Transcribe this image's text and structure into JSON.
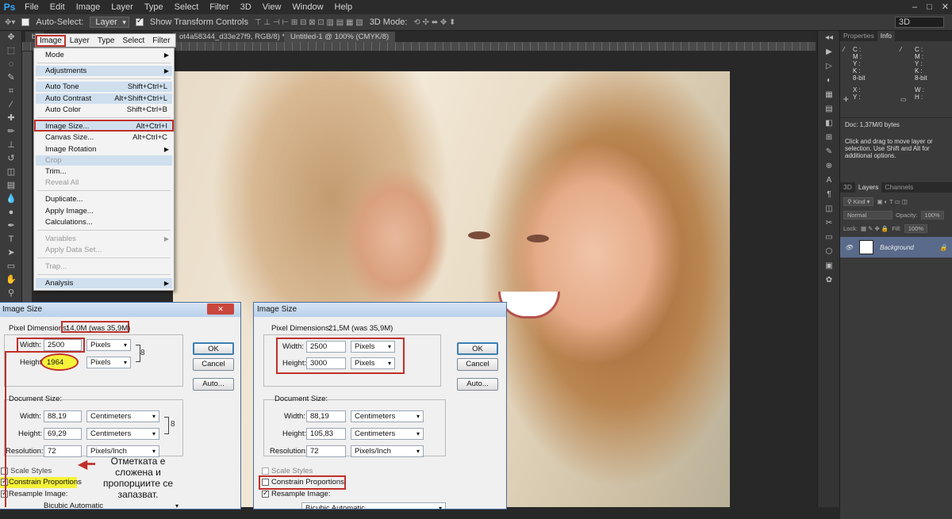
{
  "app": {
    "logo": "Ps",
    "menu": [
      "File",
      "Edit",
      "Image",
      "Layer",
      "Type",
      "Select",
      "Filter",
      "3D",
      "View",
      "Window",
      "Help"
    ],
    "window_controls": [
      "–",
      "□",
      "✕"
    ]
  },
  "options_bar": {
    "auto_select_label": "Auto-Select:",
    "auto_select_value": "Layer",
    "show_transform_label": "Show Transform Controls",
    "three_d_mode_label": "3D Mode:",
    "workspace_value": "3D"
  },
  "tabs": [
    {
      "label": "bl"
    },
    {
      "label": "ot4a58344_d33e27f9, RGB/8) *"
    },
    {
      "label": "Untitled-1 @ 100% (CMYK/8)"
    }
  ],
  "image_menu": {
    "header": [
      "Image",
      "Layer",
      "Type",
      "Select",
      "Filter"
    ],
    "items": [
      {
        "label": "Mode",
        "shortcut": "",
        "submenu": true,
        "state": "normal"
      },
      {
        "label": "Adjustments",
        "shortcut": "",
        "submenu": true,
        "state": "highlight"
      },
      {
        "label": "Auto Tone",
        "shortcut": "Shift+Ctrl+L",
        "submenu": false,
        "state": "highlight"
      },
      {
        "label": "Auto Contrast",
        "shortcut": "Alt+Shift+Ctrl+L",
        "submenu": false,
        "state": "highlight"
      },
      {
        "label": "Auto Color",
        "shortcut": "Shift+Ctrl+B",
        "submenu": false,
        "state": "normal"
      },
      {
        "label": "Image Size...",
        "shortcut": "Alt+Ctrl+I",
        "submenu": false,
        "state": "highlight"
      },
      {
        "label": "Canvas Size...",
        "shortcut": "Alt+Ctrl+C",
        "submenu": false,
        "state": "normal"
      },
      {
        "label": "Image Rotation",
        "shortcut": "",
        "submenu": true,
        "state": "normal"
      },
      {
        "label": "Crop",
        "shortcut": "",
        "submenu": false,
        "state": "disabled"
      },
      {
        "label": "Trim...",
        "shortcut": "",
        "submenu": false,
        "state": "normal"
      },
      {
        "label": "Reveal All",
        "shortcut": "",
        "submenu": false,
        "state": "disabled"
      },
      {
        "label": "Duplicate...",
        "shortcut": "",
        "submenu": false,
        "state": "normal"
      },
      {
        "label": "Apply Image...",
        "shortcut": "",
        "submenu": false,
        "state": "normal"
      },
      {
        "label": "Calculations...",
        "shortcut": "",
        "submenu": false,
        "state": "normal"
      },
      {
        "label": "Variables",
        "shortcut": "",
        "submenu": true,
        "state": "disabled"
      },
      {
        "label": "Apply Data Set...",
        "shortcut": "",
        "submenu": false,
        "state": "disabled"
      },
      {
        "label": "Trap...",
        "shortcut": "",
        "submenu": false,
        "state": "disabled"
      },
      {
        "label": "Analysis",
        "shortcut": "",
        "submenu": true,
        "state": "highlight"
      }
    ]
  },
  "dialog_left": {
    "title": "Image Size",
    "pixel_dimensions_label": "Pixel Dimensions:",
    "pixel_dimensions_value": "14,0M (was 35,9M)",
    "width_label": "Width:",
    "width_value": "2500",
    "width_unit": "Pixels",
    "height_label": "Height:",
    "height_value": "1964",
    "height_unit": "Pixels",
    "document_size_label": "Document Size:",
    "doc_width_label": "Width:",
    "doc_width_value": "88,19",
    "doc_width_unit": "Centimeters",
    "doc_height_label": "Height:",
    "doc_height_value": "69,29",
    "doc_height_unit": "Centimeters",
    "resolution_label": "Resolution:",
    "resolution_value": "72",
    "resolution_unit": "Pixels/Inch",
    "scale_styles_label": "Scale Styles",
    "constrain_label": "Constrain Proportions",
    "resample_label": "Resample Image:",
    "resample_value": "Bicubic Automatic",
    "ok_label": "OK",
    "cancel_label": "Cancel",
    "auto_label": "Auto...",
    "close_glyph": "✕"
  },
  "dialog_right": {
    "title": "Image Size",
    "pixel_dimensions_label": "Pixel Dimensions:",
    "pixel_dimensions_value": "21,5M (was 35,9M)",
    "width_label": "Width:",
    "width_value": "2500",
    "width_unit": "Pixels",
    "height_label": "Height:",
    "height_value": "3000",
    "height_unit": "Pixels",
    "document_size_label": "Document Size:",
    "doc_width_label": "Width:",
    "doc_width_value": "88,19",
    "doc_width_unit": "Centimeters",
    "doc_height_label": "Height:",
    "doc_height_value": "105,83",
    "doc_height_unit": "Centimeters",
    "resolution_label": "Resolution:",
    "resolution_value": "72",
    "resolution_unit": "Pixels/Inch",
    "scale_styles_label": "Scale Styles",
    "constrain_label": "Constrain Proportions",
    "resample_label": "Resample Image:",
    "resample_value": "Bicubic Automatic",
    "ok_label": "OK",
    "cancel_label": "Cancel",
    "auto_label": "Auto...",
    "close_glyph": "✕"
  },
  "annotation": {
    "text": "Отметката е сложена и пропорциите се запазват."
  },
  "right_panel": {
    "top_tabs": [
      "Properties",
      "Info"
    ],
    "info_left": [
      "C :",
      "M :",
      "Y :",
      "K :",
      "8-bit"
    ],
    "info_right": [
      "C :",
      "M :",
      "Y :",
      "K :",
      "8-bit"
    ],
    "xy_left": [
      "X :",
      "Y :"
    ],
    "wh_right": [
      "W :",
      "H :"
    ],
    "doc_size": "Doc: 1,37M/0 bytes",
    "hint": "Click and drag to move layer or selection.  Use Shift and Alt for additional options.",
    "layer_tabs": [
      "3D",
      "Layers",
      "Channels"
    ],
    "kind_label": "Kind",
    "blend_mode": "Normal",
    "opacity_label": "Opacity:",
    "opacity_value": "100%",
    "lock_label": "Lock:",
    "fill_label": "Fill:",
    "fill_value": "100%",
    "layer_name": "Background"
  },
  "colors": {
    "accent_red": "#c0302a",
    "highlight_yellow": "#f5f23a",
    "menu_highlight": "#cfdfee",
    "layer_selected": "#5a6a8a"
  }
}
